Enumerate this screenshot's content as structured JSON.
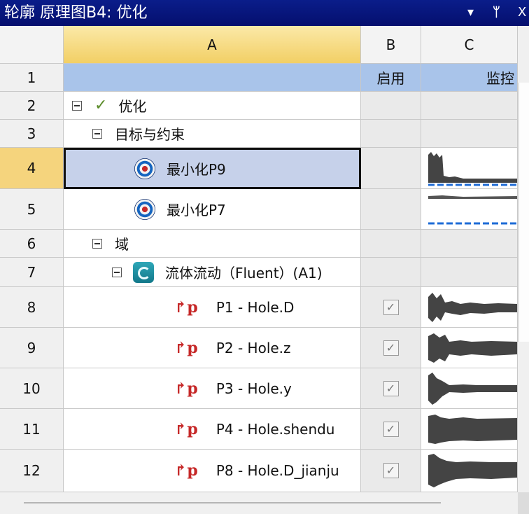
{
  "window": {
    "title": "轮廓 原理图B4: 优化",
    "pin_glyph": "▾",
    "pin2_glyph": "ᚲ",
    "close_glyph": "X"
  },
  "columns": {
    "num": "",
    "a": "A",
    "b": "B",
    "c": "C"
  },
  "row1": {
    "num": "1",
    "b": "启用",
    "c": "监控"
  },
  "rows": [
    {
      "num": "2",
      "label": "优化"
    },
    {
      "num": "3",
      "label": "目标与约束"
    },
    {
      "num": "4",
      "label": "最小化P9"
    },
    {
      "num": "5",
      "label": "最小化P7"
    },
    {
      "num": "6",
      "label": "域"
    },
    {
      "num": "7",
      "label": "流体流动（Fluent）(A1)"
    },
    {
      "num": "8",
      "label": "P1 - Hole.D"
    },
    {
      "num": "9",
      "label": "P2 - Hole.z"
    },
    {
      "num": "10",
      "label": "P3 - Hole.y"
    },
    {
      "num": "11",
      "label": "P4 - Hole.shendu"
    },
    {
      "num": "12",
      "label": "P8 - Hole.D_jianju"
    }
  ],
  "glyphs": {
    "check": "✓",
    "checkbox": "✓",
    "param": "↱p"
  },
  "colors": {
    "title_bg": "#0a1d8a",
    "header_a": "#f2cf65",
    "row1_bg": "#a9c4ea",
    "selected_row": "#c6d1ea",
    "chart_dark": "#444444",
    "chart_blue": "#1e6bd6"
  }
}
